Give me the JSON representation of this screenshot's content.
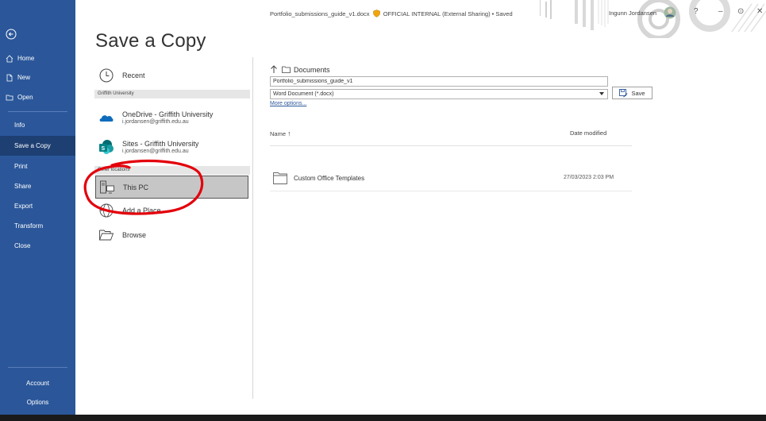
{
  "window": {
    "doc_name": "Portfolio_submissions_guide_v1.docx",
    "sensitivity": "OFFICIAL INTERNAL (External Sharing) • Saved",
    "user_name": "Ingunn Jordansen",
    "help": "?",
    "minimize": "–",
    "restore": "⊙",
    "close": "✕"
  },
  "sidebar": {
    "top_items": [
      {
        "label": "Home"
      },
      {
        "label": "New"
      },
      {
        "label": "Open"
      }
    ],
    "items": [
      {
        "label": "Info"
      },
      {
        "label": "Save a Copy"
      },
      {
        "label": "Print"
      },
      {
        "label": "Share"
      },
      {
        "label": "Export"
      },
      {
        "label": "Transform"
      },
      {
        "label": "Close"
      }
    ],
    "bottom_items": [
      {
        "label": "Account"
      },
      {
        "label": "Options"
      }
    ]
  },
  "page_title": "Save a Copy",
  "locations": {
    "recent": "Recent",
    "section_griffith": "Griffith University",
    "onedrive": {
      "title": "OneDrive - Griffith University",
      "sub": "i.jordansen@griffith.edu.au"
    },
    "sites": {
      "title": "Sites - Griffith University",
      "sub": "i.jordansen@griffith.edu.au"
    },
    "section_other": "Other locations",
    "this_pc": "This PC",
    "add_place": "Add a Place",
    "browse": "Browse"
  },
  "save_panel": {
    "folder": "Documents",
    "filename": "Portfolio_submissions_guide_v1",
    "filetype": "Word Document (*.docx)",
    "save_label": "Save",
    "more_options": "More options...",
    "col_name": "Name",
    "col_sort_arrow": "↑",
    "col_date": "Date modified",
    "files": [
      {
        "name": "Custom Office Templates",
        "date": "27/03/2023 2:03 PM"
      }
    ]
  }
}
